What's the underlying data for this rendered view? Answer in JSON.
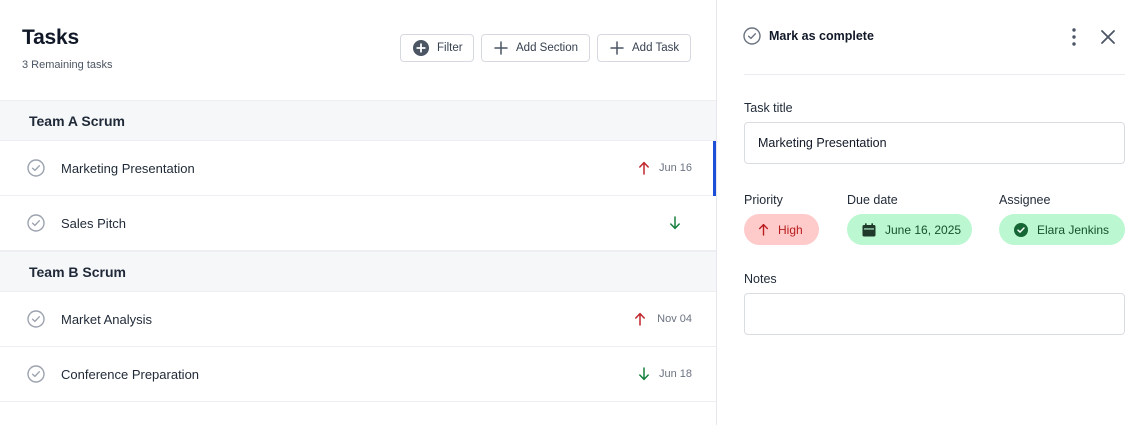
{
  "header": {
    "title": "Tasks",
    "subtitle": "3 Remaining tasks"
  },
  "toolbar": {
    "filter_label": "Filter",
    "add_section_label": "Add Section",
    "add_task_label": "Add Task"
  },
  "sections": [
    {
      "name": "Team A Scrum",
      "tasks": [
        {
          "name": "Marketing Presentation",
          "priority": "high",
          "date": "Jun 16",
          "selected": true
        },
        {
          "name": "Sales Pitch",
          "priority": "low",
          "date": ""
        }
      ]
    },
    {
      "name": "Team B Scrum",
      "tasks": [
        {
          "name": "Market Analysis",
          "priority": "high",
          "date": "Nov 04"
        },
        {
          "name": "Conference Preparation",
          "priority": "low",
          "date": "Jun 18"
        }
      ]
    }
  ],
  "detail": {
    "mark_complete_label": "Mark as complete",
    "task_title_label": "Task title",
    "task_title_value": "Marketing Presentation",
    "priority_label": "Priority",
    "priority_value": "High",
    "due_date_label": "Due date",
    "due_date_value": "June 16, 2025",
    "assignee_label": "Assignee",
    "assignee_value": "Elara Jenkins",
    "notes_label": "Notes",
    "notes_value": ""
  },
  "colors": {
    "high": "#c0262d",
    "low": "#15803d",
    "selected_bar": "#1d4ed8",
    "pill_red_bg": "#fecaca",
    "pill_green_bg": "#bbf7d0"
  },
  "icons": {
    "filter": "plus-circle-icon",
    "add": "plus-icon",
    "check": "check-circle-icon",
    "priority_high": "arrow-up-icon",
    "priority_low": "arrow-down-icon",
    "kebab": "more-vertical-icon",
    "close": "close-icon",
    "calendar": "calendar-icon",
    "assignee": "check-badge-icon"
  }
}
